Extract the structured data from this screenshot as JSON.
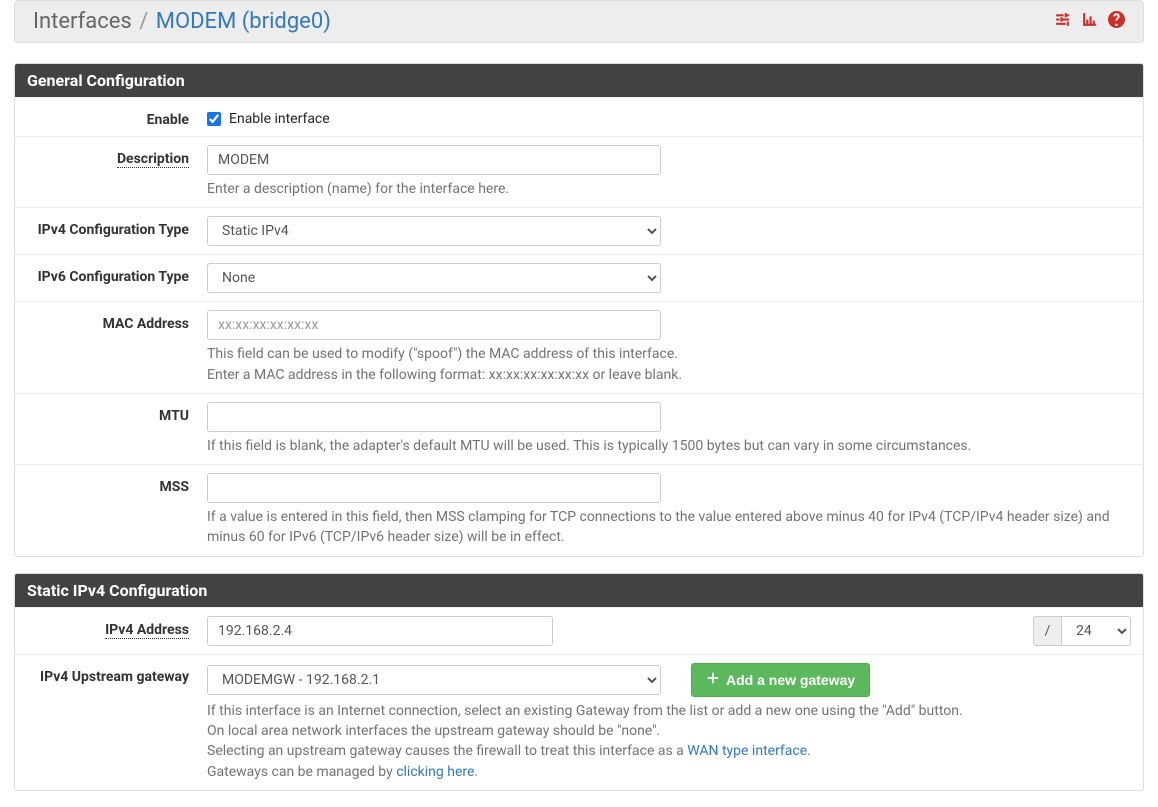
{
  "header": {
    "title_main": "Interfaces",
    "title_sep": "/",
    "title_sub": "MODEM (bridge0)"
  },
  "panels": {
    "general": {
      "heading": "General Configuration",
      "enable": {
        "label": "Enable",
        "checkbox_label": "Enable interface",
        "checked": true
      },
      "description": {
        "label": "Description",
        "value": "MODEM",
        "help": "Enter a description (name) for the interface here."
      },
      "ipv4_type": {
        "label": "IPv4 Configuration Type",
        "value": "Static IPv4"
      },
      "ipv6_type": {
        "label": "IPv6 Configuration Type",
        "value": "None"
      },
      "mac": {
        "label": "MAC Address",
        "placeholder": "xx:xx:xx:xx:xx:xx",
        "value": "",
        "help_line1": "This field can be used to modify (\"spoof\") the MAC address of this interface.",
        "help_line2": "Enter a MAC address in the following format: xx:xx:xx:xx:xx:xx or leave blank."
      },
      "mtu": {
        "label": "MTU",
        "value": "",
        "help": "If this field is blank, the adapter's default MTU will be used. This is typically 1500 bytes but can vary in some circumstances."
      },
      "mss": {
        "label": "MSS",
        "value": "",
        "help": "If a value is entered in this field, then MSS clamping for TCP connections to the value entered above minus 40 for IPv4 (TCP/IPv4 header size) and minus 60 for IPv6 (TCP/IPv6 header size) will be in effect."
      }
    },
    "static_ipv4": {
      "heading": "Static IPv4 Configuration",
      "ipv4_address": {
        "label": "IPv4 Address",
        "value": "192.168.2.4",
        "slash": "/",
        "prefix": "24"
      },
      "gateway": {
        "label": "IPv4 Upstream gateway",
        "value": "MODEMGW - 192.168.2.1",
        "button": "Add a new gateway",
        "help_line1": "If this interface is an Internet connection, select an existing Gateway from the list or add a new one using the \"Add\" button.",
        "help_line2": "On local area network interfaces the upstream gateway should be \"none\".",
        "help_line3_pre": "Selecting an upstream gateway causes the firewall to treat this interface as a ",
        "help_line3_link": "WAN type interface",
        "help_line3_post": ".",
        "help_line4_pre": "Gateways can be managed by ",
        "help_line4_link": "clicking here",
        "help_line4_post": "."
      }
    }
  }
}
